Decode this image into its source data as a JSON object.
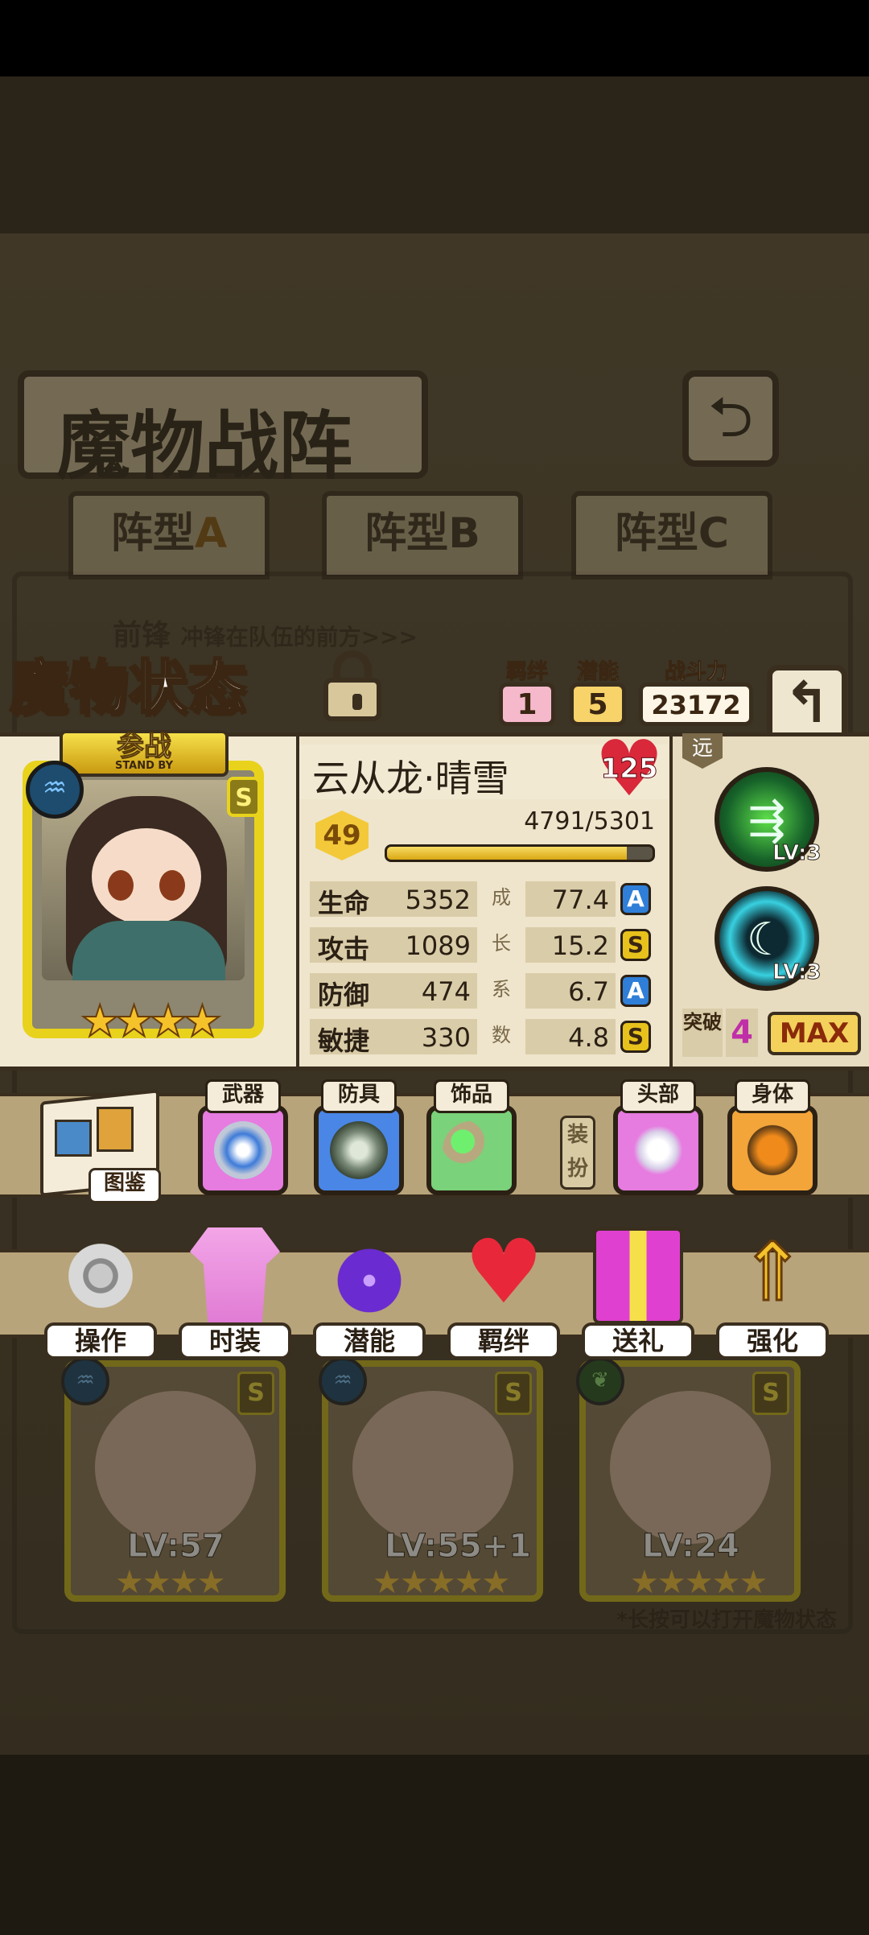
{
  "background": {
    "title": "魔物战阵",
    "formation_tabs": [
      {
        "label": "阵型",
        "letter": "A"
      },
      {
        "label": "阵型",
        "letter": "B"
      },
      {
        "label": "阵型",
        "letter": "C"
      }
    ],
    "row_label": "前锋",
    "row_desc": "冲锋在队伍的前方>>>",
    "team_cards": [
      {
        "level": "LV:57",
        "stars": "★★★★",
        "rank": "S",
        "class_icon": "water-icon"
      },
      {
        "level": "LV:55+1",
        "stars": "★★★★★",
        "rank": "S",
        "class_icon": "water-icon"
      },
      {
        "level": "LV:24",
        "stars": "★★★★★",
        "rank": "S",
        "class_icon": "leaf-icon"
      }
    ],
    "hint": "*长按可以打开魔物状态"
  },
  "status": {
    "title": "魔物状态",
    "bond": {
      "label": "羁绊",
      "value": "1"
    },
    "potential": {
      "label": "潜能",
      "value": "5"
    },
    "power": {
      "label": "战斗力",
      "value": "23172"
    }
  },
  "monster": {
    "name": "云从龙·晴雪",
    "heart_level": "125",
    "standby_cn": "参战",
    "standby_en": "STAND BY",
    "rank": "S",
    "stars": "★★★★",
    "level": "49",
    "xp_text": "4791/5301",
    "xp_fraction": 0.904,
    "growth_label_chars": [
      "成",
      "长",
      "系",
      "数"
    ],
    "stats": [
      {
        "name": "生命",
        "value": "5352",
        "growth": "77.4",
        "grade": "A"
      },
      {
        "name": "攻击",
        "value": "1089",
        "growth": "15.2",
        "grade": "S"
      },
      {
        "name": "防御",
        "value": "474",
        "growth": "6.7",
        "grade": "A"
      },
      {
        "name": "敏捷",
        "value": "330",
        "growth": "4.8",
        "grade": "S"
      }
    ],
    "range": "远",
    "skills": [
      {
        "level": "LV:3",
        "icon": "triple-arrow-skill-icon"
      },
      {
        "level": "LV:3",
        "icon": "crescent-skill-icon"
      }
    ],
    "breakthrough_label": "突破",
    "breakthrough_value": "4",
    "max_label": "MAX"
  },
  "equipment": {
    "book_label": "图鉴",
    "weapon": "武器",
    "armor": "防具",
    "accessory": "饰品",
    "dress_label": "装扮",
    "head": "头部",
    "body": "身体"
  },
  "actions": [
    {
      "label": "操作",
      "icon": "gear-icon"
    },
    {
      "label": "时装",
      "icon": "outfit-icon"
    },
    {
      "label": "潜能",
      "icon": "demon-icon"
    },
    {
      "label": "羁绊",
      "icon": "hearts-icon"
    },
    {
      "label": "送礼",
      "icon": "gift-icon"
    },
    {
      "label": "强化",
      "icon": "upgrade-arrows-icon"
    }
  ],
  "colors": {
    "panel_bg": "#efe5cc",
    "outline": "#3a2e1f",
    "gold_frame": "#e8d21c",
    "grade_A": "#2f7ed8",
    "grade_S": "#e8c21c",
    "heart": "#d8283a"
  }
}
